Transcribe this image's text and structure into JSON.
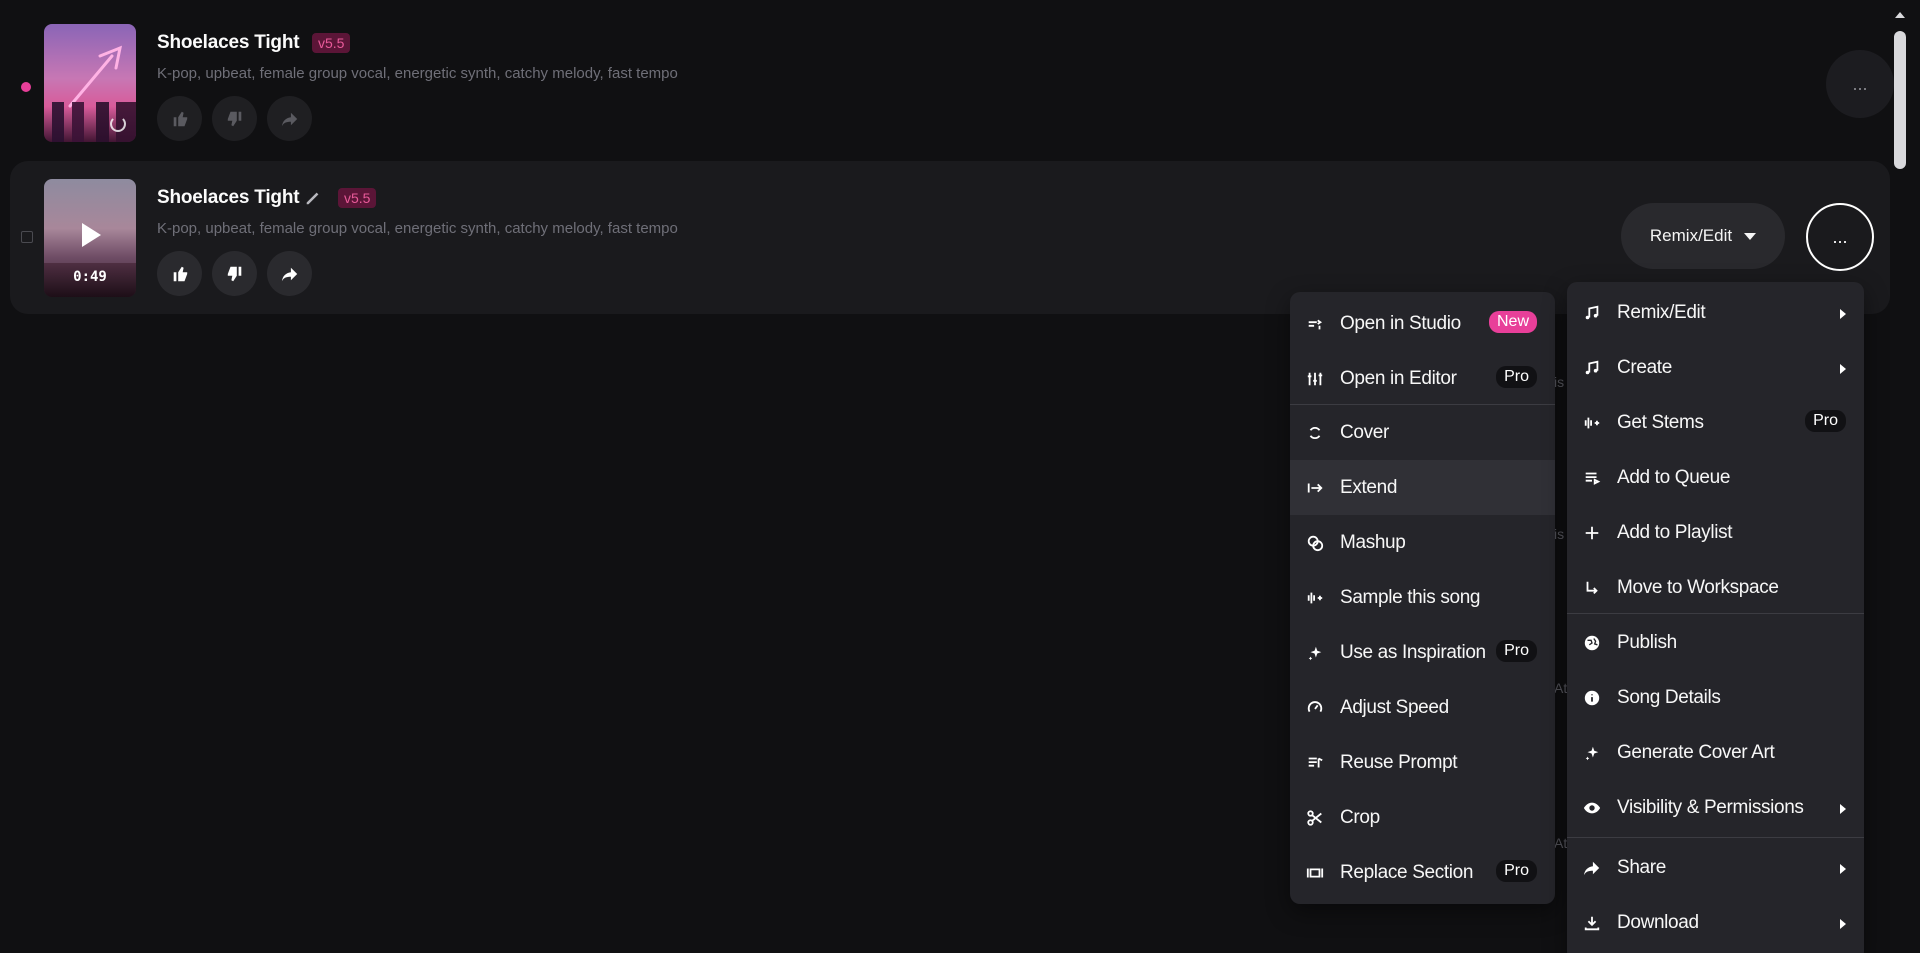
{
  "songs": [
    {
      "title": "Shoelaces Tight",
      "version": "v5.5",
      "tags": "K-pop, upbeat, female group vocal, energetic synth, catchy melody, fast tempo"
    },
    {
      "title": "Shoelaces Tight",
      "version": "v5.5",
      "tags": "K-pop, upbeat, female group vocal, energetic synth, catchy melody, fast tempo",
      "duration": "0:49",
      "remix_label": "Remix/Edit"
    }
  ],
  "more_label": "...",
  "left_menu": [
    {
      "label": "Open in Studio",
      "badge": "New",
      "icon": "studio-icon"
    },
    {
      "label": "Open in Editor",
      "badge": "Pro",
      "icon": "sliders-icon"
    },
    {
      "label": "Cover",
      "icon": "refresh-icon"
    },
    {
      "label": "Extend",
      "icon": "extend-icon"
    },
    {
      "label": "Mashup",
      "icon": "mashup-icon"
    },
    {
      "label": "Sample this song",
      "icon": "waveform-icon"
    },
    {
      "label": "Use as Inspiration",
      "badge": "Pro",
      "icon": "sparkle-icon"
    },
    {
      "label": "Adjust Speed",
      "icon": "speed-icon"
    },
    {
      "label": "Reuse Prompt",
      "icon": "prompt-icon"
    },
    {
      "label": "Crop",
      "icon": "scissors-icon"
    },
    {
      "label": "Replace Section",
      "badge": "Pro",
      "icon": "replace-icon"
    }
  ],
  "right_menu": [
    {
      "label": "Remix/Edit",
      "icon": "music-note-icon"
    },
    {
      "label": "Create",
      "icon": "music-note-icon"
    },
    {
      "label": "Get Stems",
      "badge": "Pro",
      "icon": "stems-icon"
    },
    {
      "label": "Add to Queue",
      "icon": "queue-icon"
    },
    {
      "label": "Add to Playlist",
      "icon": "plus-icon"
    },
    {
      "label": "Move to Workspace",
      "icon": "move-icon"
    },
    {
      "label": "Publish",
      "icon": "globe-icon"
    },
    {
      "label": "Song Details",
      "icon": "info-icon"
    },
    {
      "label": "Generate Cover Art",
      "icon": "sparkle-icon"
    },
    {
      "label": "Visibility & Permissions",
      "icon": "eye-icon"
    },
    {
      "label": "Share",
      "icon": "share-icon"
    },
    {
      "label": "Download",
      "icon": "download-icon"
    }
  ],
  "colors": {
    "accent": "#e83f99",
    "background": "#101012",
    "menu": "#25252a"
  }
}
